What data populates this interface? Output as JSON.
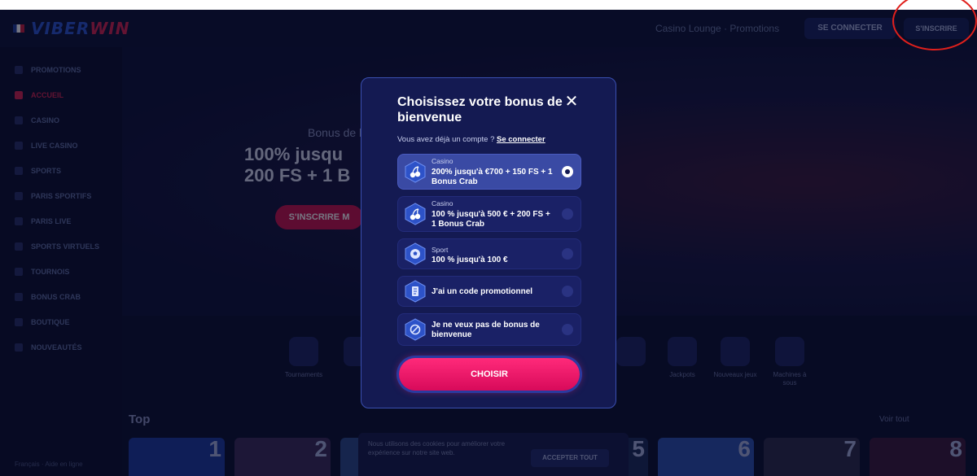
{
  "header": {
    "brand_part1": "VIBER",
    "brand_part2": "WIN",
    "support_link": "Casino Lounge · Promotions",
    "login_label": "SE CONNECTER",
    "signup_label": "S'INSCRIRE"
  },
  "sidebar": {
    "items": [
      {
        "label": "PROMOTIONS"
      },
      {
        "label": "ACCUEIL",
        "active": true
      },
      {
        "label": "CASINO"
      },
      {
        "label": "LIVE CASINO"
      },
      {
        "label": "SPORTS"
      },
      {
        "label": "PARIS SPORTIFS"
      },
      {
        "label": "PARIS LIVE"
      },
      {
        "label": "SPORTS VIRTUELS"
      },
      {
        "label": "TOURNOIS"
      },
      {
        "label": "BONUS CRAB"
      },
      {
        "label": "BOUTIQUE"
      },
      {
        "label": "NOUVEAUTÉS"
      }
    ],
    "footer": "Français · Aide en ligne"
  },
  "hero": {
    "subtitle": "Bonus de b",
    "title_line1": "100% jusqu",
    "title_line2": "200 FS + 1 B",
    "button": "S'INSCRIRE M"
  },
  "categories": [
    {
      "label": "Tournaments"
    },
    {
      "label": ""
    },
    {
      "label": ""
    },
    {
      "label": ""
    },
    {
      "label": "Jackpots"
    },
    {
      "label": "Nouveaux jeux"
    },
    {
      "label": "Machines à sous"
    }
  ],
  "top": {
    "label": "Top",
    "see_all": "Voir tout",
    "numbers": [
      "1",
      "2",
      "5",
      "6",
      "7",
      "8"
    ]
  },
  "cookie": {
    "text": "Nous utilisons des cookies pour améliorer votre expérience sur notre site web.",
    "button": "ACCEPTER TOUT"
  },
  "modal": {
    "title": "Choisissez votre bonus de bienvenue",
    "account_text": "Vous avez déjà un compte ?",
    "account_link": "Se connecter",
    "options": [
      {
        "category": "Casino",
        "text": "200% jusqu'à €700 + 150 FS + 1 Bonus Crab",
        "icon": "cherries-icon",
        "selected": true
      },
      {
        "category": "Casino",
        "text": "100 % jusqu'à 500 € + 200 FS + 1 Bonus Crab",
        "icon": "cherries-icon",
        "selected": false
      },
      {
        "category": "Sport",
        "text": "100 % jusqu'à 100 €",
        "icon": "soccer-ball-icon",
        "selected": false
      },
      {
        "category": "",
        "text": "J'ai un code promotionnel",
        "icon": "promo-code-icon",
        "selected": false
      },
      {
        "category": "",
        "text": "Je ne veux pas de bonus de bienvenue",
        "icon": "no-bonus-icon",
        "selected": false
      }
    ],
    "choose_button": "CHOISIR"
  }
}
